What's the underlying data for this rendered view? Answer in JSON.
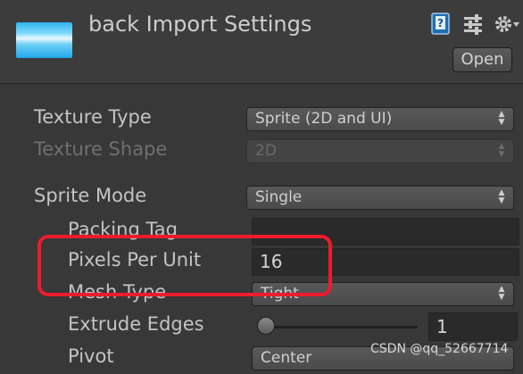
{
  "header": {
    "title": "back Import Settings",
    "open_label": "Open",
    "icons": [
      "help-book-icon",
      "preset-sliders-icon",
      "gear-menu-icon"
    ]
  },
  "fields": {
    "texture_type": {
      "label": "Texture Type",
      "value": "Sprite (2D and UI)"
    },
    "texture_shape": {
      "label": "Texture Shape",
      "value": "2D"
    },
    "sprite_mode": {
      "label": "Sprite Mode",
      "value": "Single"
    },
    "packing_tag": {
      "label": "Packing Tag",
      "value": ""
    },
    "pixels_per_unit": {
      "label": "Pixels Per Unit",
      "value": "16"
    },
    "mesh_type": {
      "label": "Mesh Type",
      "value": "Tight"
    },
    "extrude_edges": {
      "label": "Extrude Edges",
      "value": "1",
      "slider_fraction": 0.03
    },
    "pivot": {
      "label": "Pivot",
      "value": "Center"
    }
  },
  "watermark": "CSDN @qq_52667714",
  "colors": {
    "highlight": "#ee1c2d",
    "panel": "#383838"
  }
}
